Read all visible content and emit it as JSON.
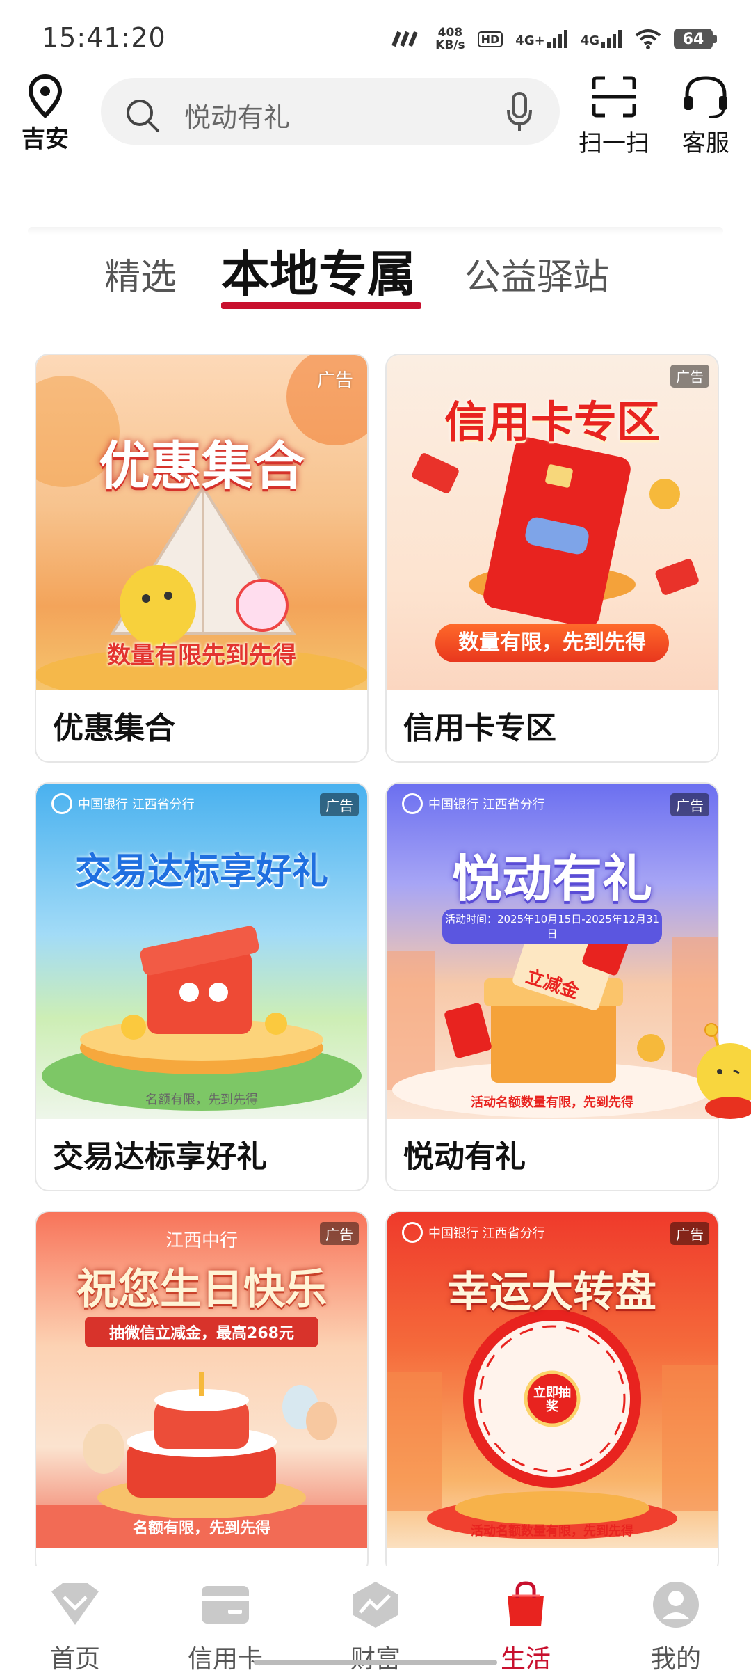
{
  "status_bar": {
    "time": "15:41:20",
    "speed_value": "408",
    "speed_unit": "KB/s",
    "hd": "HD",
    "sim1": "4G+",
    "sim2": "4G",
    "battery": "64"
  },
  "header": {
    "location": "吉安",
    "search_placeholder": "悦动有礼",
    "scan_label": "扫一扫",
    "service_label": "客服"
  },
  "tabs": [
    {
      "label": "精选",
      "active": false
    },
    {
      "label": "本地专属",
      "active": true
    },
    {
      "label": "公益驿站",
      "active": false
    }
  ],
  "cards": [
    {
      "title": "优惠集合",
      "ad": "广告",
      "banner_title": "优惠集合",
      "banner_sub": "数量有限先到先得"
    },
    {
      "title": "信用卡专区",
      "ad": "广告",
      "banner_title": "信用卡专区",
      "banner_sub": "数量有限，先到先得"
    },
    {
      "title": "交易达标享好礼",
      "ad": "广告",
      "banner_title": "交易达标享好礼",
      "banner_sub": "名额有限，先到先得"
    },
    {
      "title": "悦动有礼",
      "ad": "广告",
      "banner_title": "悦动有礼",
      "banner_date": "活动时间：2025年10月15日-2025年12月31日",
      "banner_tag": "立减金",
      "banner_sub": "活动名额数量有限，先到先得"
    },
    {
      "title": "",
      "ad": "广告",
      "banner_top": "江西中行",
      "banner_title": "祝您生日快乐",
      "banner_ribbon": "抽微信立减金，最高268元",
      "banner_sub": "名额有限，先到先得"
    },
    {
      "title": "",
      "ad": "广告",
      "banner_title": "幸运大转盘",
      "banner_center": "立即抽奖",
      "banner_sub": "活动名额数量有限，先到先得"
    }
  ],
  "brand_text": "中国银行 江西省分行",
  "bottom_nav": [
    {
      "label": "首页",
      "icon": "diamond-icon",
      "active": false
    },
    {
      "label": "信用卡",
      "icon": "card-icon",
      "active": false
    },
    {
      "label": "财富",
      "icon": "wealth-icon",
      "active": false
    },
    {
      "label": "生活",
      "icon": "bag-icon",
      "active": true
    },
    {
      "label": "我的",
      "icon": "profile-icon",
      "active": false
    }
  ],
  "colors": {
    "accent": "#c8102e"
  }
}
